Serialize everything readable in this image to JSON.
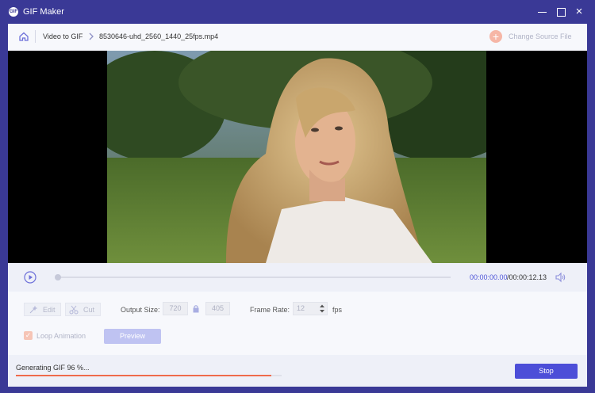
{
  "window": {
    "title": "GIF Maker",
    "app_icon_text": "GIF",
    "close_glyph": "×"
  },
  "breadcrumb": {
    "root": "Video to GIF",
    "file": "8530646-uhd_2560_1440_25fps.mp4"
  },
  "change_source": {
    "label": "Change Source File",
    "icon": "plus-circle-icon"
  },
  "player": {
    "current_time": "00:00:00.00",
    "total_time": "/00:00:12.13",
    "position": 0.0
  },
  "options": {
    "edit_label": "Edit",
    "cut_label": "Cut",
    "output_size_label": "Output Size:",
    "width": "720",
    "height": "405",
    "frame_rate_label": "Frame Rate:",
    "frame_rate": "12",
    "fps_label": "fps",
    "loop_label": "Loop Animation",
    "loop_checked": true,
    "preview_label": "Preview"
  },
  "status": {
    "text": "Generating GIF 96 %...",
    "progress": 0.96,
    "stop_label": "Stop"
  },
  "colors": {
    "titlebar": "#3a3996",
    "accent": "#4c4ed8",
    "progress": "#ef6a4c",
    "time": "#4f55d8"
  }
}
